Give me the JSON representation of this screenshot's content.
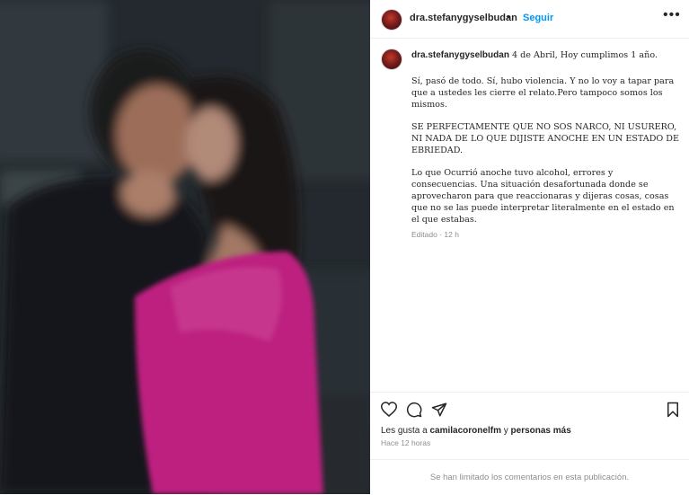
{
  "post": {
    "username": "dra.stefanygyselbudan",
    "separator": "•",
    "follow_label": "Seguir",
    "more_label": "•••"
  },
  "caption": {
    "username": "dra.stefanygyselbudan",
    "intro": "4 de Abril, Hoy cumplimos 1 año.",
    "p1": "Sí, pasó de todo. Sí, hubo violencia. Y no lo voy a tapar para que a ustedes les cierre el relato.Pero tampoco somos los mismos.",
    "p2": "SE PERFECTAMENTE QUE NO SOS NARCO, NI USURERO, NI NADA DE LO QUE DIJISTE ANOCHE EN UN ESTADO DE EBRIEDAD.",
    "p3": "Lo que Ocurrió anoche tuvo alcohol, errores y consecuencias. Una situación desafortunada donde se aprovecharon para que reaccionaras y dijeras cosas, cosas que no se las puede interpretar literalmente en el estado en el que estabas.",
    "edited": "Editado · 12 h"
  },
  "likes": {
    "prefix": "Les gusta a ",
    "user": "camilacoronelfm",
    "middle": " y ",
    "others": "personas más"
  },
  "time_ago": "Hace 12 horas",
  "comments_limited": "Se han limitado los comentarios en esta publicación.",
  "icons": [
    "heart-icon",
    "comment-icon",
    "share-icon",
    "bookmark-icon",
    "more-icon"
  ],
  "colors": {
    "link": "#0095f6",
    "muted": "#8e8e8e",
    "dress": "#d6248f"
  }
}
